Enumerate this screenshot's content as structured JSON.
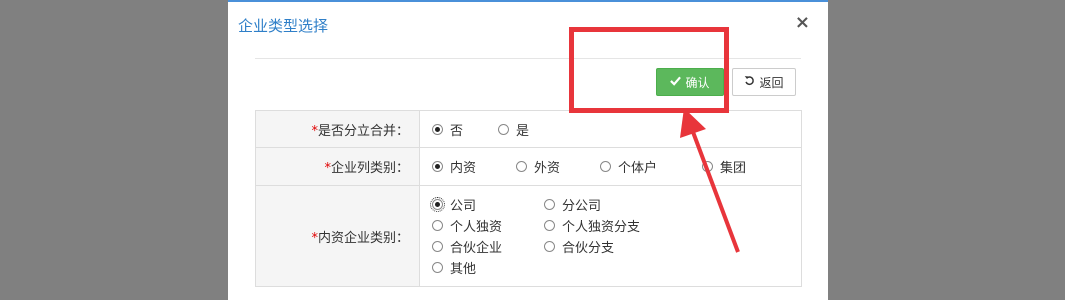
{
  "dialog": {
    "title": "企业类型选择",
    "close_symbol": "×",
    "confirm_label": "确认",
    "back_label": "返回"
  },
  "form": {
    "rows": [
      {
        "label": "是否分立合并：",
        "required": "*",
        "options": [
          "否",
          "是"
        ],
        "selected": "否"
      },
      {
        "label": "企业列类别：",
        "required": "*",
        "options": [
          "内资",
          "外资",
          "个体户",
          "集团"
        ],
        "selected": "内资"
      },
      {
        "label": "内资企业类别：",
        "required": "*",
        "options": [
          "公司",
          "分公司",
          "个人独资",
          "个人独资分支",
          "合伙企业",
          "合伙分支",
          "其他"
        ],
        "selected": "公司"
      }
    ]
  },
  "annotation": {
    "color": "#e8353b",
    "box_icon": "highlight-box",
    "arrow_icon": "red-arrow"
  },
  "colors": {
    "title": "#2f7fc8",
    "confirm_bg": "#5cb85c",
    "required": "#e00000"
  }
}
